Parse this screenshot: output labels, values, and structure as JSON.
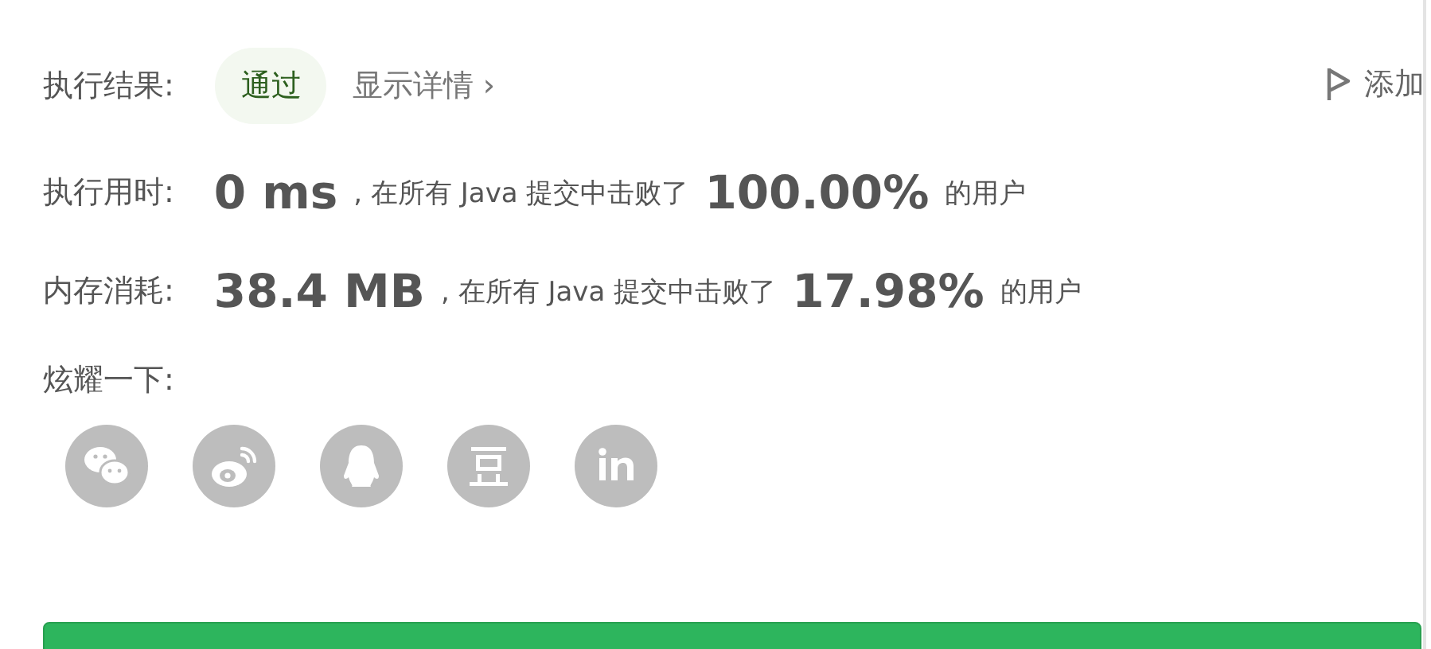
{
  "result": {
    "label": "执行结果:",
    "status": "通过",
    "details_link": "显示详情",
    "details_arrow": "›"
  },
  "add_note": {
    "label": "添加"
  },
  "stats": [
    {
      "label": "执行用时:",
      "value": "0 ms",
      "text_before": ", 在所有 Java 提交中击败了",
      "percent": "100.00%",
      "text_after": "的用户"
    },
    {
      "label": "内存消耗:",
      "value": "38.4 MB",
      "text_before": ", 在所有 Java 提交中击败了",
      "percent": "17.98%",
      "text_after": "的用户"
    }
  ],
  "share": {
    "label": "炫耀一下:",
    "icons": [
      {
        "kind": "wechat"
      },
      {
        "kind": "weibo"
      },
      {
        "kind": "qq"
      },
      {
        "kind": "douban"
      },
      {
        "kind": "linkedin"
      }
    ]
  },
  "bottom_button": {
    "kind": "button"
  }
}
